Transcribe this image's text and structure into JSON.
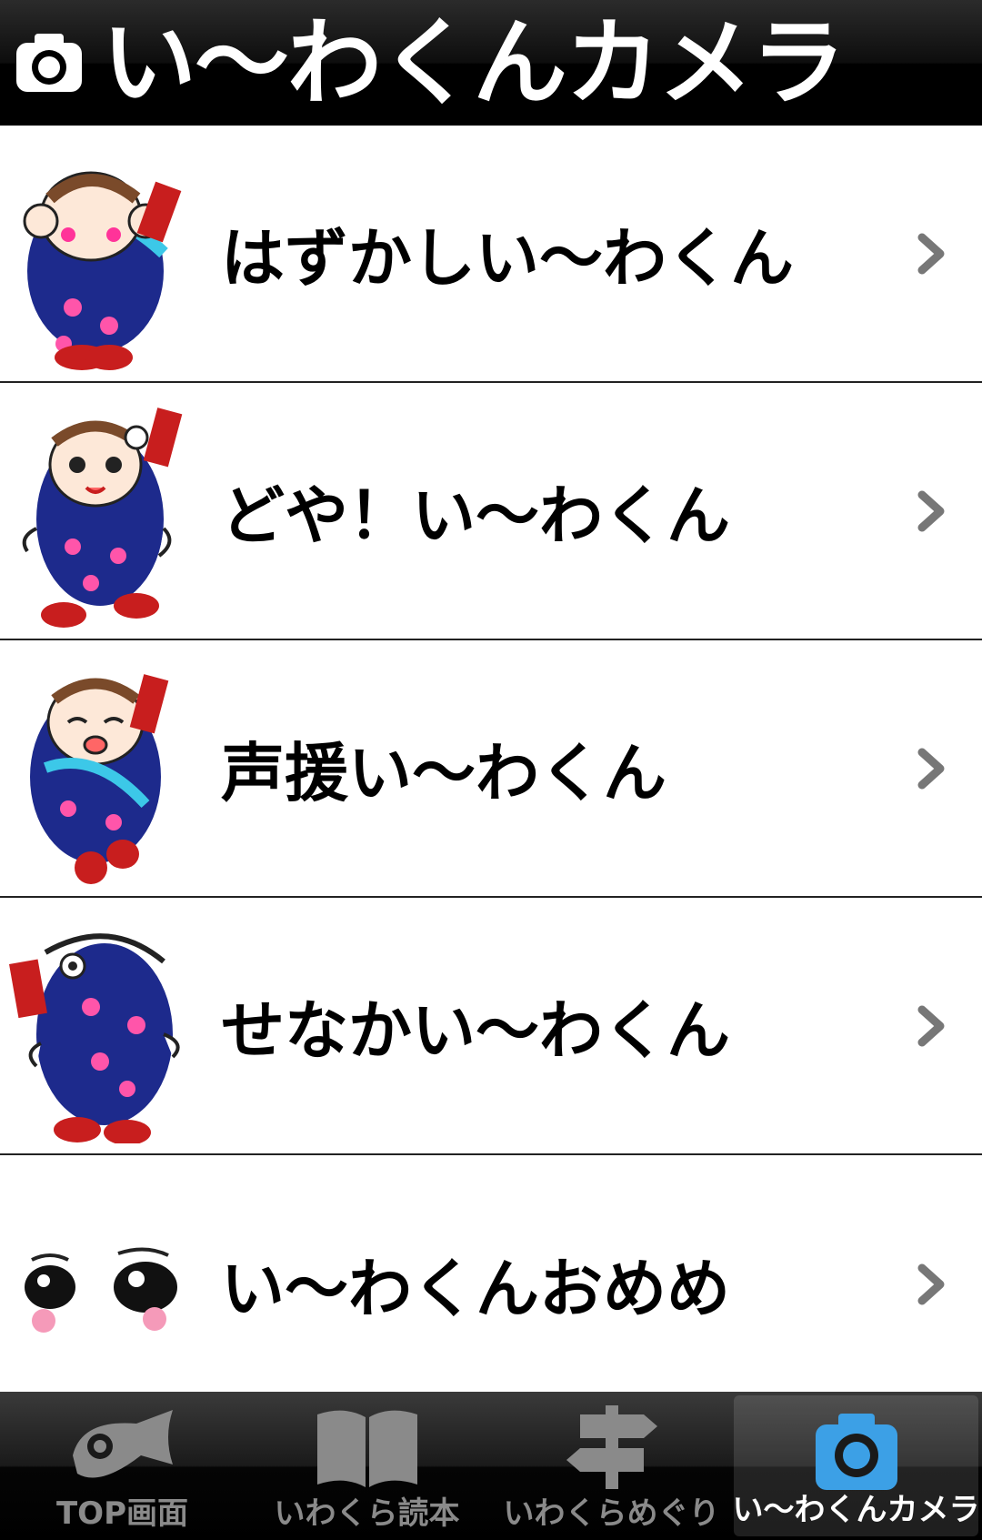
{
  "header": {
    "title": "い〜わくんカメラ",
    "icon": "camera-icon"
  },
  "list": {
    "items": [
      {
        "label": "はずかしい〜わくん",
        "icon": "character-shy-icon"
      },
      {
        "label": "どや！い〜わくん",
        "icon": "character-proud-icon"
      },
      {
        "label": "声援い〜わくん",
        "icon": "character-cheer-icon"
      },
      {
        "label": "せなかい〜わくん",
        "icon": "character-back-icon"
      },
      {
        "label": "い〜わくんおめめ",
        "icon": "character-eyes-icon"
      }
    ]
  },
  "tabbar": {
    "tabs": [
      {
        "label": "TOP画面",
        "icon": "fish-icon",
        "active": false
      },
      {
        "label": "いわくら読本",
        "icon": "book-icon",
        "active": false
      },
      {
        "label": "いわくらめぐり",
        "icon": "signpost-icon",
        "active": false
      },
      {
        "label": "い〜わくんカメラ",
        "icon": "camera-icon",
        "active": true
      }
    ]
  },
  "colors": {
    "character_blue": "#1d2a8c",
    "accent_red": "#c81e1e",
    "active_camera_blue": "#3ca0e6"
  }
}
